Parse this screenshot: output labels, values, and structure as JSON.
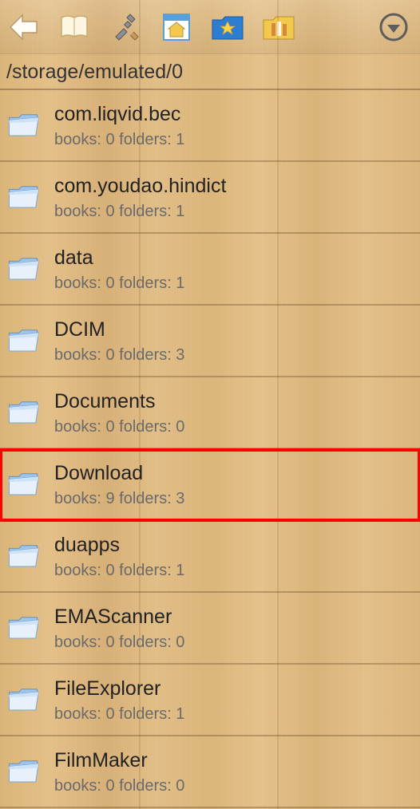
{
  "path": "/storage/emulated/0",
  "meta_labels": {
    "books": "books:",
    "folders": "folders:"
  },
  "folders": [
    {
      "name": "com.liqvid.bec",
      "books": 0,
      "folders": 1,
      "highlight": false
    },
    {
      "name": "com.youdao.hindict",
      "books": 0,
      "folders": 1,
      "highlight": false
    },
    {
      "name": "data",
      "books": 0,
      "folders": 1,
      "highlight": false
    },
    {
      "name": "DCIM",
      "books": 0,
      "folders": 3,
      "highlight": false
    },
    {
      "name": "Documents",
      "books": 0,
      "folders": 0,
      "highlight": false
    },
    {
      "name": "Download",
      "books": 9,
      "folders": 3,
      "highlight": true
    },
    {
      "name": "duapps",
      "books": 0,
      "folders": 1,
      "highlight": false
    },
    {
      "name": "EMAScanner",
      "books": 0,
      "folders": 0,
      "highlight": false
    },
    {
      "name": "FileExplorer",
      "books": 0,
      "folders": 1,
      "highlight": false
    },
    {
      "name": "FilmMaker",
      "books": 0,
      "folders": 0,
      "highlight": false
    }
  ]
}
